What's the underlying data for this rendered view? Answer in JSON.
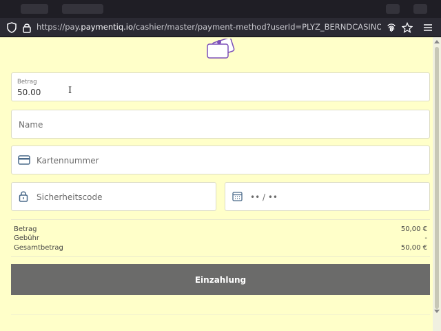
{
  "browser": {
    "url_prefix": "https://pay.",
    "url_domain": "paymentiq.io",
    "url_path": "/cashier/master/payment-method?userId=PLYZ_BERNDCASINO&merchantId="
  },
  "form": {
    "amount_label": "Betrag",
    "amount_value": "50.00",
    "name_placeholder": "Name",
    "card_placeholder": "Kartennummer",
    "cvv_placeholder": "Sicherheitscode",
    "expiry_placeholder": "•• / ••"
  },
  "summary": {
    "rows": [
      {
        "label": "Betrag",
        "value": "50,00 €"
      },
      {
        "label": "Gebühr",
        "value": "-"
      },
      {
        "label": "Gesamtbetrag",
        "value": "50,00 €"
      }
    ]
  },
  "submit_label": "Einzahlung",
  "colors": {
    "page_bg": "#ffffc9",
    "button_bg": "#6b6b6a",
    "accent": "#7b4fb8"
  }
}
